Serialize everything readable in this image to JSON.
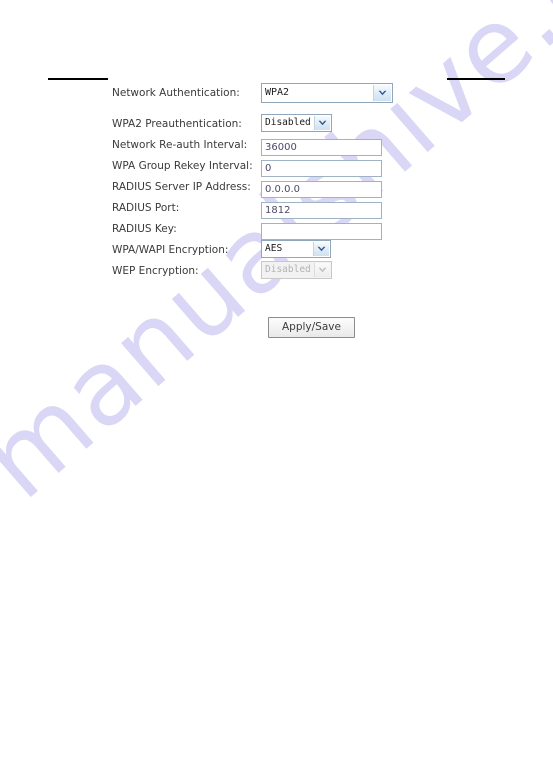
{
  "page": {
    "background_color": "#ffffff",
    "watermark_text": "manualshive.com",
    "watermark_color": "#d7d5f5"
  },
  "rules": {
    "left_rule": "",
    "right_rule": ""
  },
  "form": {
    "rows": [
      {
        "label": "Network Authentication:",
        "control": "select",
        "value": "WPA2",
        "name": "network-authentication",
        "disabled": false
      },
      {
        "label": "WPA2 Preauthentication:",
        "control": "select",
        "value": "Disabled",
        "name": "wpa2-preauthentication",
        "disabled": false
      },
      {
        "label": "Network Re-auth Interval:",
        "control": "text",
        "value": "36000",
        "name": "network-reauth-interval",
        "disabled": false
      },
      {
        "label": "WPA Group Rekey Interval:",
        "control": "text",
        "value": "0",
        "name": "wpa-group-rekey-interval",
        "disabled": false
      },
      {
        "label": "RADIUS Server IP Address:",
        "control": "text",
        "value": "0.0.0.0",
        "name": "radius-server-ip-address",
        "disabled": false
      },
      {
        "label": "RADIUS Port:",
        "control": "text",
        "value": "1812",
        "name": "radius-port",
        "disabled": false
      },
      {
        "label": "RADIUS Key:",
        "control": "text",
        "value": "",
        "name": "radius-key",
        "disabled": false
      },
      {
        "label": "WPA/WAPI Encryption:",
        "control": "select",
        "value": "AES",
        "name": "wpa-wapi-encryption",
        "disabled": false
      },
      {
        "label": "WEP Encryption:",
        "control": "select",
        "value": "Disabled",
        "name": "wep-encryption",
        "disabled": true
      }
    ]
  },
  "actions": {
    "apply_save_label": "Apply/Save"
  },
  "colors": {
    "input_border": "#9fb3c4",
    "select_border": "#8fa6bb",
    "arrow_blue": "#2f5c93",
    "label_text": "#3a3a3a",
    "rule_black": "#000000"
  }
}
